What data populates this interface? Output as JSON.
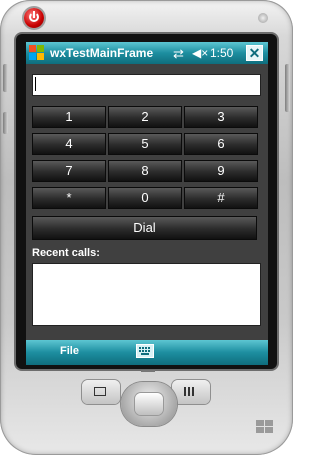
{
  "window": {
    "title": "wxTestMainFrame",
    "clock": "1:50",
    "close_label": "✕"
  },
  "dialer": {
    "number_value": "",
    "keys": [
      "1",
      "2",
      "3",
      "4",
      "5",
      "6",
      "7",
      "8",
      "9",
      "*",
      "0",
      "#"
    ],
    "dial_label": "Dial"
  },
  "recent": {
    "label": "Recent calls:",
    "items": []
  },
  "menubar": {
    "file_label": "File"
  },
  "colors": {
    "accent": "#1d8ea0",
    "background": "#404040"
  }
}
